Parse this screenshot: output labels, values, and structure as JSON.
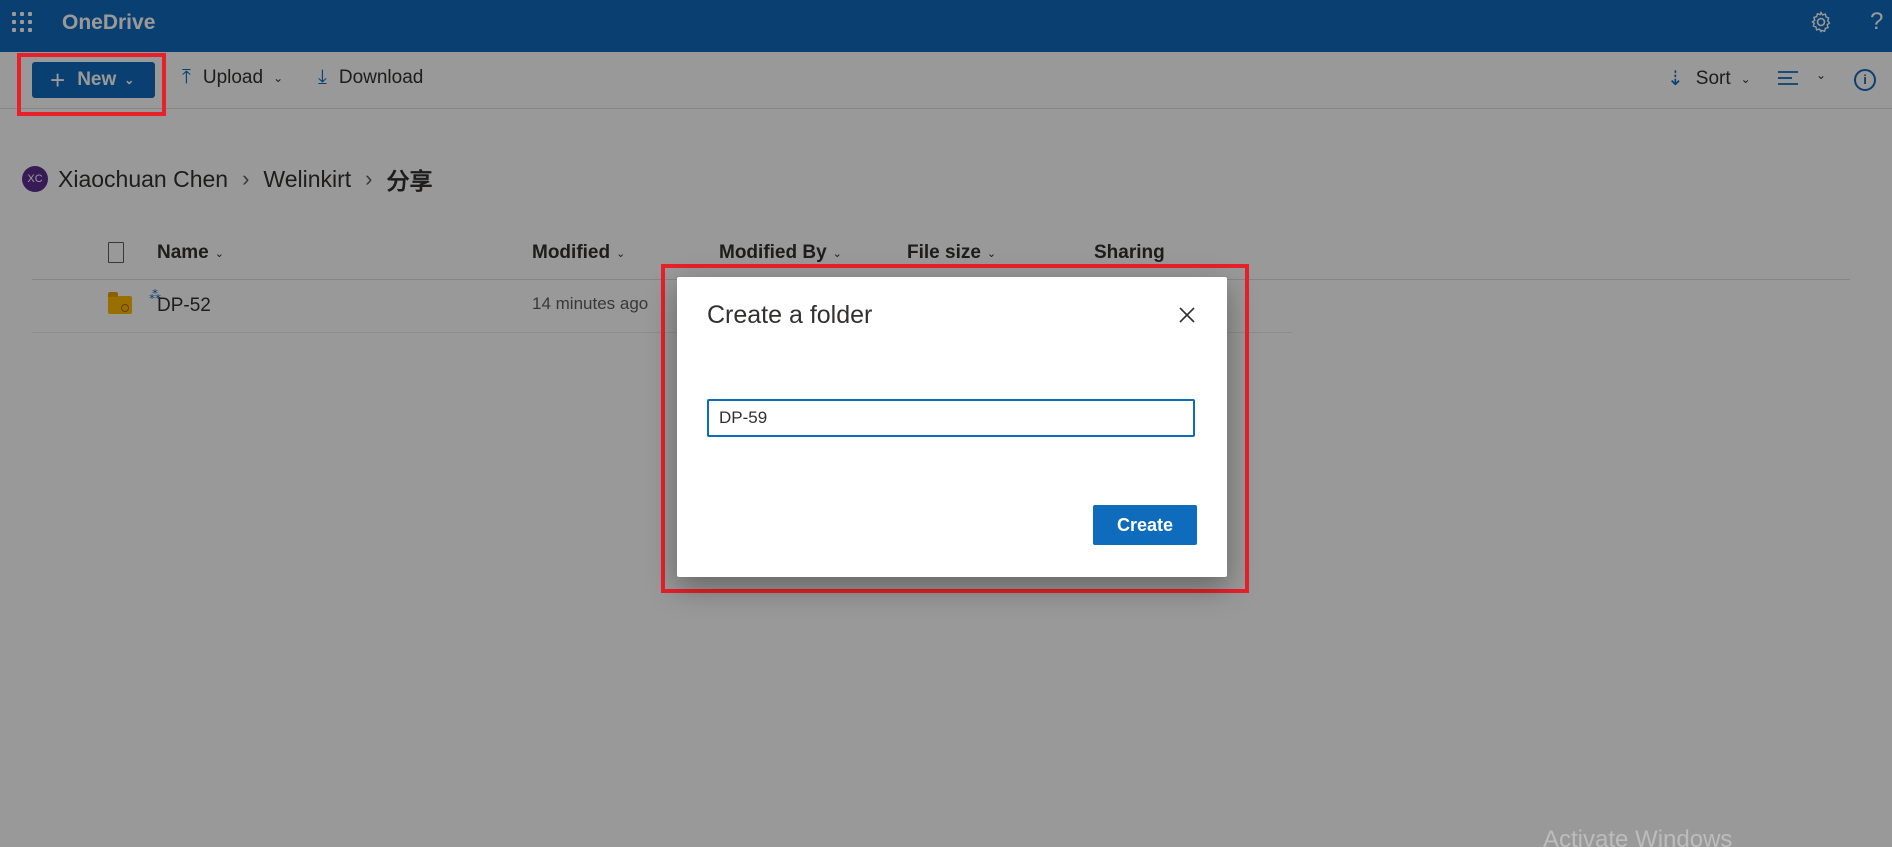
{
  "app": {
    "title": "OneDrive",
    "help_label": "?"
  },
  "toolbar": {
    "new_label": "New",
    "upload_label": "Upload",
    "download_label": "Download",
    "sort_label": "Sort",
    "info_label": "i"
  },
  "breadcrumb": {
    "avatar_initials": "XC",
    "items": [
      "Xiaochuan Chen",
      "Welinkirt",
      "分享"
    ]
  },
  "list": {
    "columns": [
      "Name",
      "Modified",
      "Modified By",
      "File size",
      "Sharing"
    ],
    "rows": [
      {
        "name": "DP-52",
        "modified": "14 minutes ago",
        "icon": "shared-folder-icon"
      }
    ]
  },
  "dialog": {
    "title": "Create a folder",
    "input_value": "DP-59",
    "create_label": "Create"
  },
  "watermark": "Activate Windows",
  "colors": {
    "brand": "#0f6cbd",
    "highlight": "#e8202a"
  }
}
